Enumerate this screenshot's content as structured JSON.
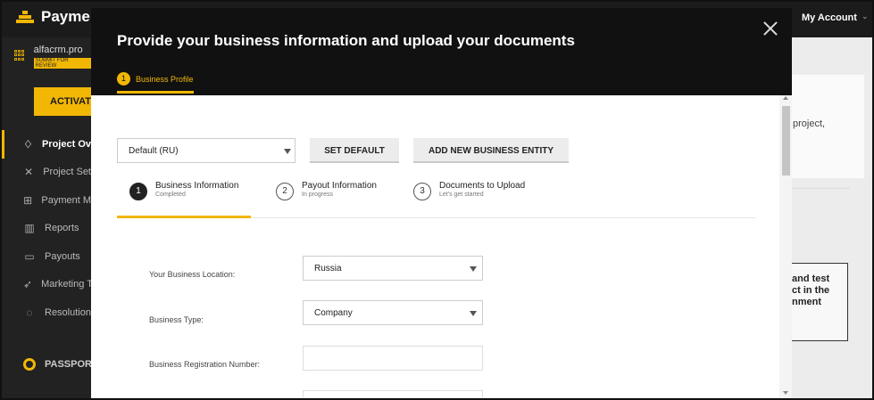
{
  "app": {
    "logo_text": "Payme",
    "account_label": "My Account"
  },
  "sidebar": {
    "project_name": "alfacrm.pro",
    "project_status": "SUBMIT FOR REVIEW",
    "activate_label": "ACTIVAT",
    "items": [
      {
        "label": "Project Ov",
        "icon": "diamond-icon"
      },
      {
        "label": "Project Set",
        "icon": "tools-icon"
      },
      {
        "label": "Payment M",
        "icon": "hierarchy-icon"
      },
      {
        "label": "Reports",
        "icon": "bar-chart-icon"
      },
      {
        "label": "Payouts",
        "icon": "wallet-icon"
      },
      {
        "label": "Marketing T",
        "icon": "rocket-icon"
      },
      {
        "label": "Resolution",
        "icon": "chat-icon"
      }
    ],
    "passport_label": "PASSPORT"
  },
  "background": {
    "card1_text": "project,",
    "card2_text": "and test\nct in the\nnment"
  },
  "modal": {
    "title": "Provide your business information and upload your documents",
    "header_tab": {
      "number": "1",
      "label": "Business Profile"
    },
    "entity_select": "Default (RU)",
    "set_default_label": "SET DEFAULT",
    "add_entity_label": "ADD NEW BUSINESS ENTITY",
    "steps": [
      {
        "number": "1",
        "title": "Business Information",
        "status": "Completed"
      },
      {
        "number": "2",
        "title": "Payout Information",
        "status": "In progress"
      },
      {
        "number": "3",
        "title": "Documents to Upload",
        "status": "Let's get started"
      }
    ],
    "form": {
      "location_label": "Your Business Location:",
      "location_value": "Russia",
      "type_label": "Business Type:",
      "type_value": "Company",
      "reg_number_label": "Business Registration Number:",
      "reg_number_value": ""
    }
  }
}
